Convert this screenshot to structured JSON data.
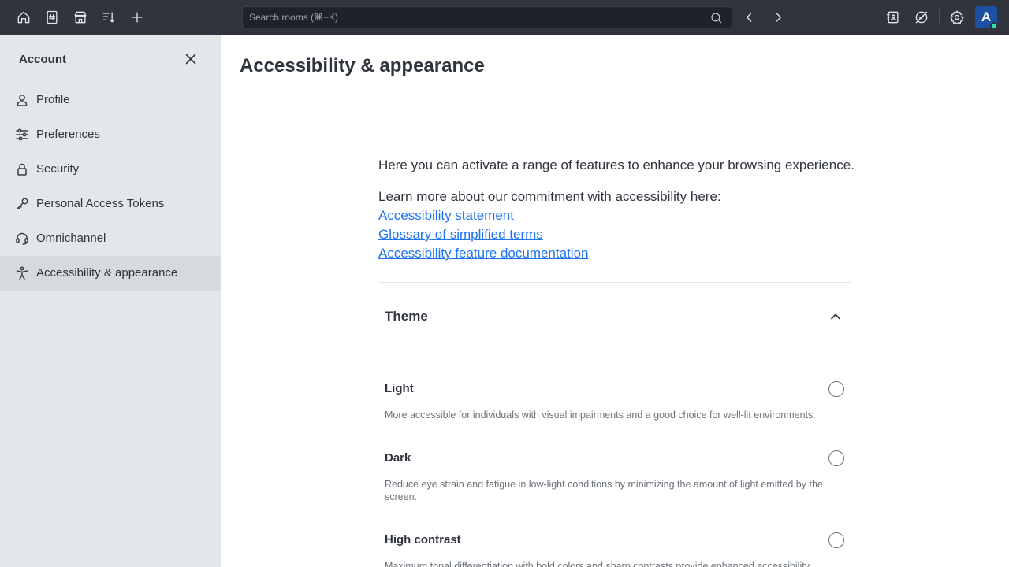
{
  "topbar": {
    "icons": [
      "home-icon",
      "directory-icon",
      "marketplace-icon",
      "sort-icon",
      "create-new-icon"
    ],
    "search": {
      "placeholder": "Search rooms (⌘+K)"
    },
    "right_icons": [
      "contact-icon",
      "omnichannel-off-icon",
      "administration-gear-icon"
    ],
    "avatar_letter": "A",
    "status_color": "#2de0a5",
    "accent": "#1d4fa3"
  },
  "sidebar": {
    "title": "Account",
    "items": [
      {
        "label": "Profile",
        "icon": "user-icon",
        "active": false
      },
      {
        "label": "Preferences",
        "icon": "sliders-icon",
        "active": false
      },
      {
        "label": "Security",
        "icon": "lock-icon",
        "active": false
      },
      {
        "label": "Personal Access Tokens",
        "icon": "key-icon",
        "active": false
      },
      {
        "label": "Omnichannel",
        "icon": "headset-icon",
        "active": false
      },
      {
        "label": "Accessibility & appearance",
        "icon": "accessibility-icon",
        "active": true
      }
    ]
  },
  "main": {
    "title": "Accessibility & appearance",
    "intro": "Here you can activate a range of features to enhance your browsing experience.",
    "learn_more": "Learn more about our commitment with accessibility here:",
    "links": [
      "Accessibility statement",
      "Glossary of simplified terms",
      "Accessibility feature documentation"
    ],
    "theme": {
      "title": "Theme",
      "options": [
        {
          "label": "Light",
          "description": "More accessible for individuals with visual impairments and a good choice for well-lit environments.",
          "selected": false
        },
        {
          "label": "Dark",
          "description": "Reduce eye strain and fatigue in low-light conditions by minimizing the amount of light emitted by the screen.",
          "selected": false
        },
        {
          "label": "High contrast",
          "description": "Maximum tonal differentiation with bold colors and sharp contrasts provide enhanced accessibility.",
          "selected": false
        }
      ]
    },
    "link_color": "#1d74f5"
  }
}
